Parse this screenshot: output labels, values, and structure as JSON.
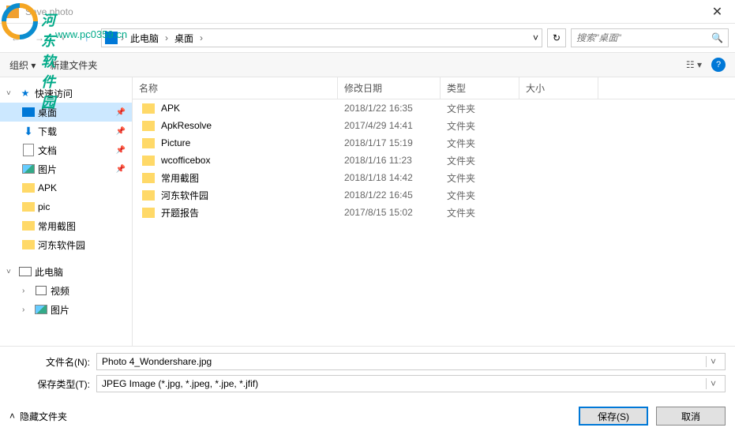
{
  "title": "Save photo",
  "watermark": {
    "text1": "河东软件园",
    "text2": "www.pc0359.cn"
  },
  "breadcrumb": {
    "pc": "此电脑",
    "location": "桌面"
  },
  "search": {
    "placeholder": "搜索\"桌面\""
  },
  "toolbar": {
    "organize": "组织",
    "newfolder": "新建文件夹"
  },
  "sidebar": {
    "quick": "快速访问",
    "desktop": "桌面",
    "downloads": "下载",
    "documents": "文档",
    "pictures": "图片",
    "apk": "APK",
    "pic": "pic",
    "screenshots": "常用截图",
    "hedong": "河东软件园",
    "thispc": "此电脑",
    "videos": "视频",
    "pictures2": "图片"
  },
  "columns": {
    "name": "名称",
    "date": "修改日期",
    "type": "类型",
    "size": "大小"
  },
  "files": [
    {
      "name": "APK",
      "date": "2018/1/22 16:35",
      "type": "文件夹"
    },
    {
      "name": "ApkResolve",
      "date": "2017/4/29 14:41",
      "type": "文件夹"
    },
    {
      "name": "Picture",
      "date": "2018/1/17 15:19",
      "type": "文件夹"
    },
    {
      "name": "wcofficebox",
      "date": "2018/1/16 11:23",
      "type": "文件夹"
    },
    {
      "name": "常用截图",
      "date": "2018/1/18 14:42",
      "type": "文件夹"
    },
    {
      "name": "河东软件园",
      "date": "2018/1/22 16:45",
      "type": "文件夹"
    },
    {
      "name": "开题报告",
      "date": "2017/8/15 15:02",
      "type": "文件夹"
    }
  ],
  "form": {
    "filename_label": "文件名(N):",
    "filename": "Photo 4_Wondershare.jpg",
    "filetype_label": "保存类型(T):",
    "filetype": "JPEG Image (*.jpg, *.jpeg, *.jpe, *.jfif)"
  },
  "actions": {
    "hide": "隐藏文件夹",
    "save": "保存(S)",
    "cancel": "取消"
  }
}
